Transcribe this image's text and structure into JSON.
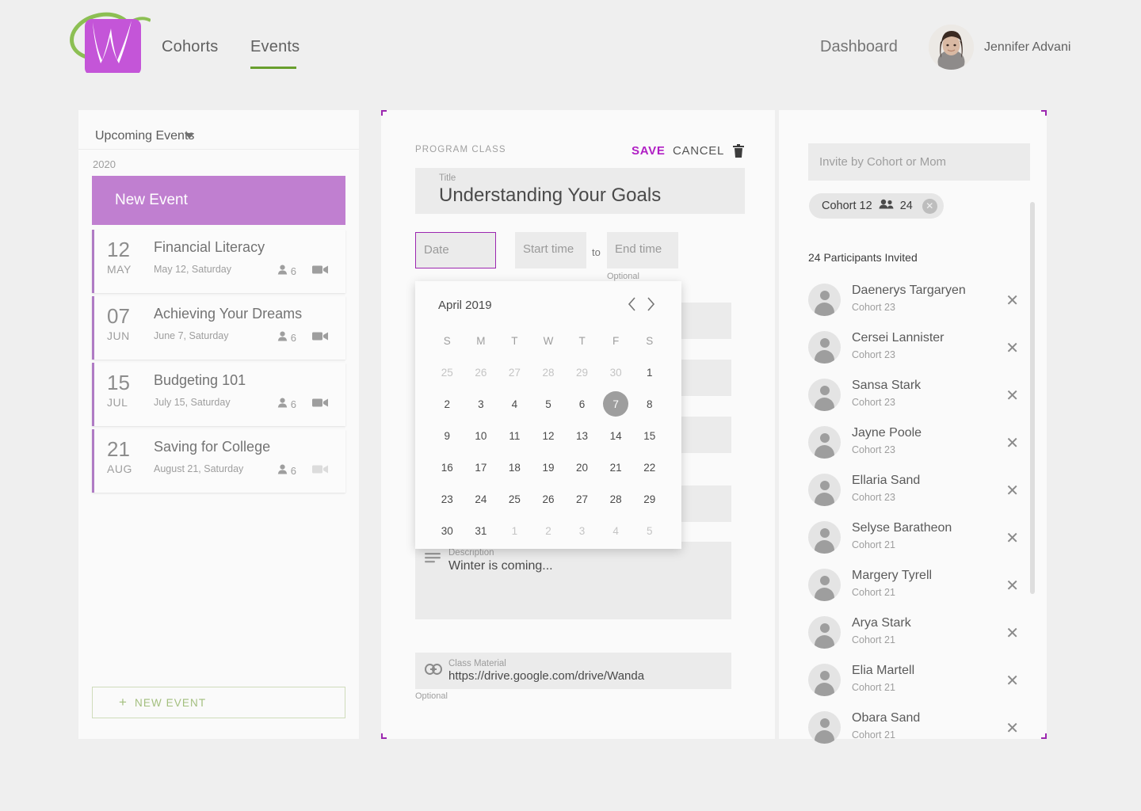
{
  "header": {
    "logo_name": "wanda-logo",
    "nav": [
      {
        "label": "Cohorts",
        "active": false
      },
      {
        "label": "Events",
        "active": true
      }
    ],
    "dashboard_label": "Dashboard",
    "user_name": "Jennifer Advani"
  },
  "colors": {
    "brand_purple": "#9c27b0",
    "logo_purple": "#c455d8",
    "logo_green": "#8cbf53",
    "accent_green": "#689f2e",
    "banner_purple": "#c07fd0",
    "save_magenta": "#b01ec4"
  },
  "left_panel": {
    "filter_label": "Upcoming Events",
    "filter_icon": "chevron-down-icon",
    "year": "2020",
    "new_event_banner": "New Event",
    "events": [
      {
        "day": "12",
        "month": "MAY",
        "title": "Financial Literacy",
        "date": "May 12, Saturday",
        "people": "6",
        "video_enabled": true
      },
      {
        "day": "07",
        "month": "JUN",
        "title": "Achieving Your Dreams",
        "date": "June 7, Saturday",
        "people": "6",
        "video_enabled": true
      },
      {
        "day": "15",
        "month": "JUL",
        "title": "Budgeting 101",
        "date": "July 15, Saturday",
        "people": "6",
        "video_enabled": true
      },
      {
        "day": "21",
        "month": "AUG",
        "title": "Saving for College",
        "date": "August 21, Saturday",
        "people": "6",
        "video_enabled": false
      }
    ],
    "new_event_button": "NEW EVENT",
    "new_event_plus": "+"
  },
  "center_panel": {
    "section_label": "PROGRAM CLASS",
    "save_label": "SAVE",
    "cancel_label": "CANCEL",
    "delete_icon": "trash-icon",
    "title_field": {
      "label": "Title",
      "value": "Understanding Your Goals"
    },
    "date_field": {
      "placeholder": "Date",
      "value": ""
    },
    "start_time_field": {
      "placeholder": "Start time",
      "value": ""
    },
    "to_label": "to",
    "end_time_field": {
      "placeholder": "End time",
      "value": ""
    },
    "time_optional_label": "Optional",
    "description_field": {
      "label": "Description",
      "value": "Winter is coming...",
      "icon": "description-lines-icon"
    },
    "class_material_field": {
      "label": "Class Material",
      "value": "https://drive.google.com/drive/Wanda",
      "icon": "link-icon"
    },
    "material_optional_label": "Optional"
  },
  "calendar": {
    "month_label": "April 2019",
    "prev_icon": "chevron-left-icon",
    "next_icon": "chevron-right-icon",
    "dow": [
      "S",
      "M",
      "T",
      "W",
      "T",
      "F",
      "S"
    ],
    "weeks": [
      [
        {
          "d": "25",
          "muted": true
        },
        {
          "d": "26",
          "muted": true
        },
        {
          "d": "27",
          "muted": true
        },
        {
          "d": "28",
          "muted": true
        },
        {
          "d": "29",
          "muted": true
        },
        {
          "d": "30",
          "muted": true
        },
        {
          "d": "1",
          "muted": false
        }
      ],
      [
        {
          "d": "2",
          "muted": false
        },
        {
          "d": "3",
          "muted": false
        },
        {
          "d": "4",
          "muted": false
        },
        {
          "d": "5",
          "muted": false
        },
        {
          "d": "6",
          "muted": false
        },
        {
          "d": "7",
          "muted": false,
          "selected": true
        },
        {
          "d": "8",
          "muted": false
        }
      ],
      [
        {
          "d": "9",
          "muted": false
        },
        {
          "d": "10",
          "muted": false
        },
        {
          "d": "11",
          "muted": false
        },
        {
          "d": "12",
          "muted": false
        },
        {
          "d": "13",
          "muted": false
        },
        {
          "d": "14",
          "muted": false
        },
        {
          "d": "15",
          "muted": false
        }
      ],
      [
        {
          "d": "16",
          "muted": false
        },
        {
          "d": "17",
          "muted": false
        },
        {
          "d": "18",
          "muted": false
        },
        {
          "d": "19",
          "muted": false
        },
        {
          "d": "20",
          "muted": false
        },
        {
          "d": "21",
          "muted": false
        },
        {
          "d": "22",
          "muted": false
        }
      ],
      [
        {
          "d": "23",
          "muted": false
        },
        {
          "d": "24",
          "muted": false
        },
        {
          "d": "25",
          "muted": false
        },
        {
          "d": "26",
          "muted": false
        },
        {
          "d": "27",
          "muted": false
        },
        {
          "d": "28",
          "muted": false
        },
        {
          "d": "29",
          "muted": false
        }
      ],
      [
        {
          "d": "30",
          "muted": false
        },
        {
          "d": "31",
          "muted": false
        },
        {
          "d": "1",
          "muted": true
        },
        {
          "d": "2",
          "muted": true
        },
        {
          "d": "3",
          "muted": true
        },
        {
          "d": "4",
          "muted": true
        },
        {
          "d": "5",
          "muted": true
        }
      ]
    ]
  },
  "right_panel": {
    "invite_placeholder": "Invite by Cohort or Mom",
    "cohort_chip": {
      "name": "Cohort 12",
      "count": "24",
      "group_icon": "people-icon",
      "remove_icon": "close-circle-icon"
    },
    "participants_count_label": "24 Participants Invited",
    "participants": [
      {
        "name": "Daenerys Targaryen",
        "cohort": "Cohort 23"
      },
      {
        "name": "Cersei Lannister",
        "cohort": "Cohort 23"
      },
      {
        "name": "Sansa Stark",
        "cohort": "Cohort 23"
      },
      {
        "name": "Jayne Poole",
        "cohort": "Cohort 23"
      },
      {
        "name": "Ellaria Sand",
        "cohort": "Cohort 23"
      },
      {
        "name": "Selyse Baratheon",
        "cohort": "Cohort 21"
      },
      {
        "name": "Margery Tyrell",
        "cohort": "Cohort 21"
      },
      {
        "name": "Arya Stark",
        "cohort": "Cohort 21"
      },
      {
        "name": "Elia Martell",
        "cohort": "Cohort 21"
      },
      {
        "name": "Obara Sand",
        "cohort": "Cohort 21"
      }
    ],
    "remove_icon": "close-icon"
  }
}
